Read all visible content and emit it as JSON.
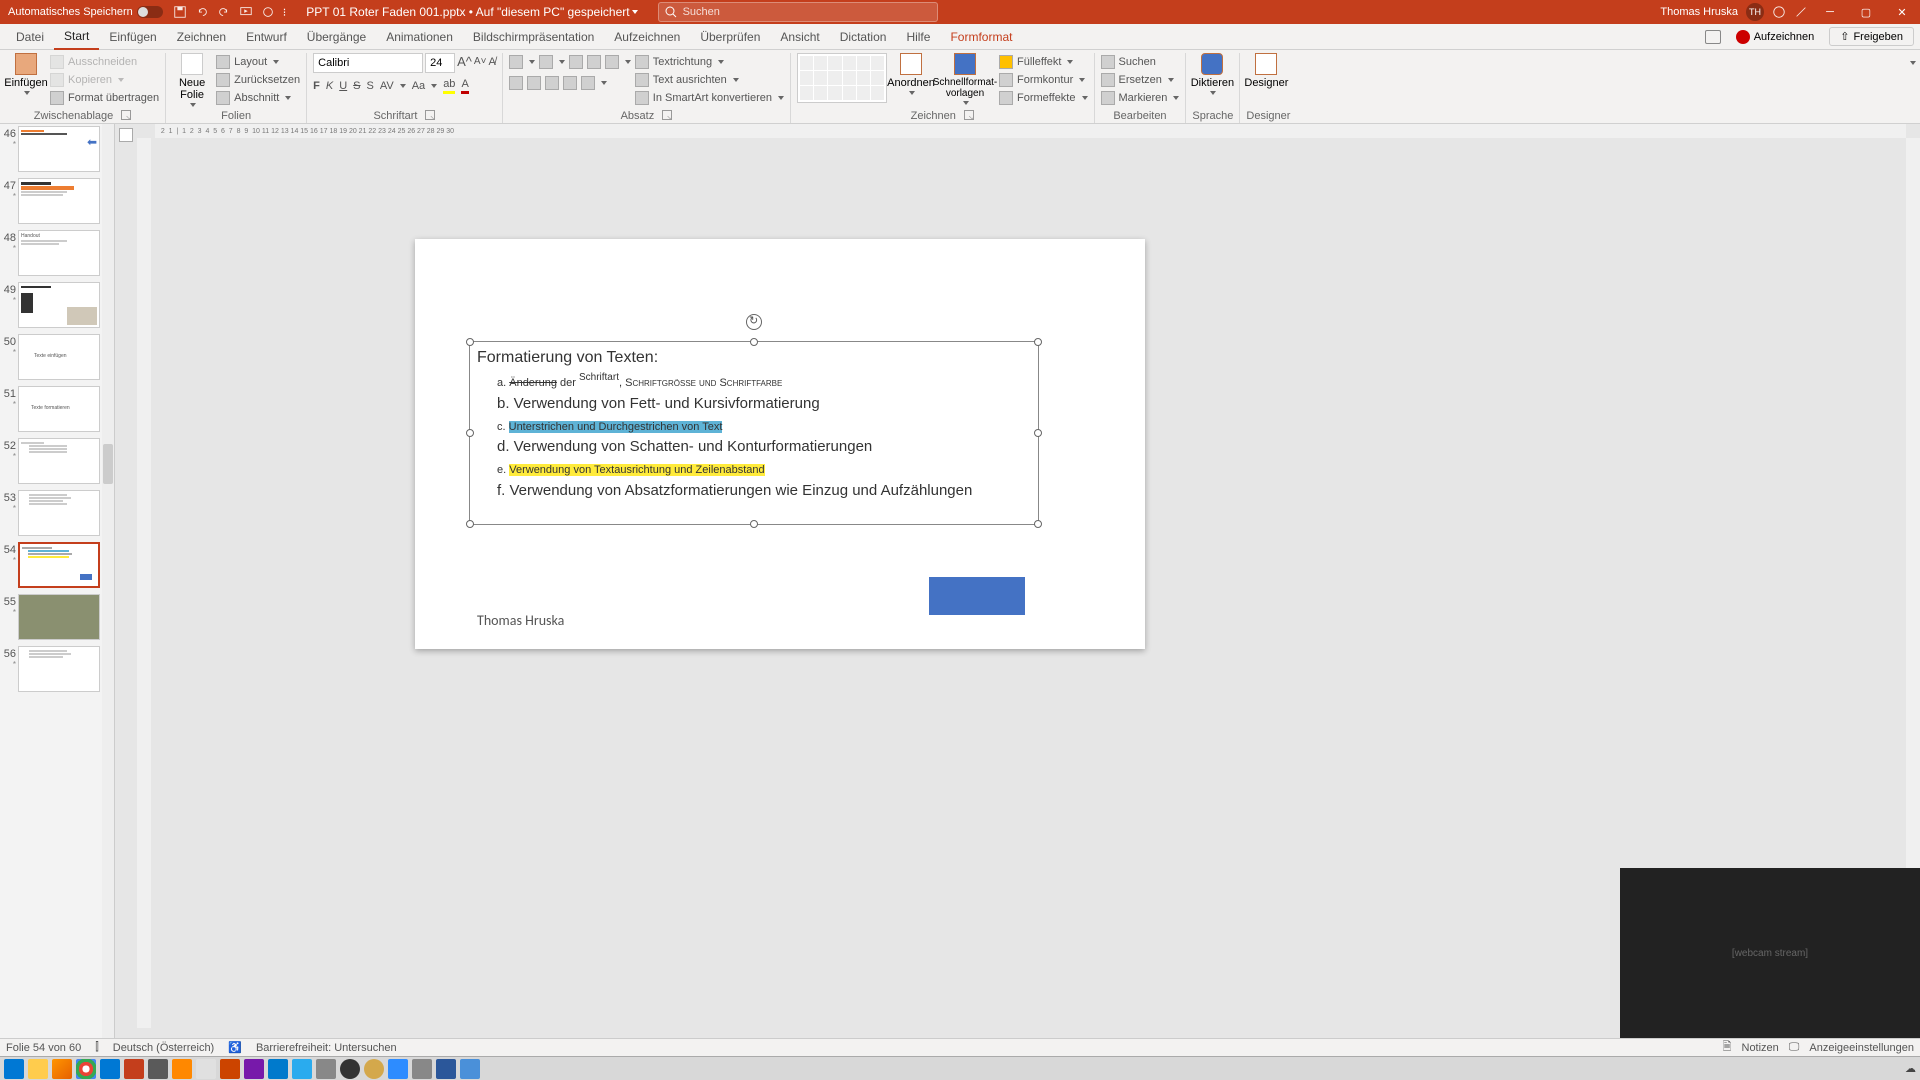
{
  "titlebar": {
    "autosave": "Automatisches Speichern",
    "filename": "PPT 01 Roter Faden 001.pptx • Auf \"diesem PC\" gespeichert",
    "search_placeholder": "Suchen",
    "username": "Thomas Hruska",
    "initials": "TH"
  },
  "tabs": {
    "datei": "Datei",
    "start": "Start",
    "einfuegen": "Einfügen",
    "zeichnen": "Zeichnen",
    "entwurf": "Entwurf",
    "uebergaenge": "Übergänge",
    "animationen": "Animationen",
    "bildschirm": "Bildschirmpräsentation",
    "aufzeichnen": "Aufzeichnen",
    "ueberpruefen": "Überprüfen",
    "ansicht": "Ansicht",
    "dictation": "Dictation",
    "hilfe": "Hilfe",
    "formformat": "Formformat",
    "record_btn": "Aufzeichnen",
    "share_btn": "Freigeben"
  },
  "ribbon": {
    "zwischenablage": {
      "label": "Zwischenablage",
      "einfuegen": "Einfügen",
      "ausschneiden": "Ausschneiden",
      "kopieren": "Kopieren",
      "format_uebertragen": "Format übertragen"
    },
    "folien": {
      "label": "Folien",
      "neue_folie": "Neue\nFolie",
      "layout": "Layout",
      "zuruecksetzen": "Zurücksetzen",
      "abschnitt": "Abschnitt"
    },
    "schriftart": {
      "label": "Schriftart",
      "font": "Calibri",
      "size": "24",
      "bold": "F",
      "italic": "K",
      "underline": "U",
      "strike": "S"
    },
    "absatz": {
      "label": "Absatz",
      "textrichtung": "Textrichtung",
      "text_ausrichten": "Text ausrichten",
      "smartart": "In SmartArt konvertieren"
    },
    "zeichnen": {
      "label": "Zeichnen",
      "anordnen": "Anordnen",
      "schnell": "Schnellformat-\nvorlagen",
      "fuelleffekt": "Fülleffekt",
      "formkontur": "Formkontur",
      "formeffekte": "Formeffekte"
    },
    "bearbeiten": {
      "label": "Bearbeiten",
      "suchen": "Suchen",
      "ersetzen": "Ersetzen",
      "markieren": "Markieren"
    },
    "sprache": {
      "label": "Sprache",
      "diktieren": "Diktieren"
    },
    "designer": {
      "label": "Designer",
      "designer": "Designer"
    }
  },
  "thumbs": {
    "n46": "46",
    "n47": "47",
    "n48": "48",
    "n49": "49",
    "n50": "50",
    "n51": "51",
    "n52": "52",
    "n53": "53",
    "n54": "54",
    "n55": "55",
    "n56": "56",
    "t48": "Handout",
    "t50": "Texte einfügen",
    "t51": "Texte formatieren"
  },
  "slide": {
    "title": "Formatierung von Texten:",
    "a_pre": "a. ",
    "a_strike": "Änderung",
    "a_mid1": " der ",
    "a_small": "Schriftart",
    "a_mid2": ", ",
    "a_sc": "Schriftgröße und Schriftfarbe",
    "b": "b. Verwendung von Fett- und Kursivformatierung",
    "c_pre": "c. ",
    "c_hl": "Unterstrichen und Durchgestrichen von Text",
    "d": "d. Verwendung von Schatten- und Konturformatierungen",
    "e_pre": "e. ",
    "e_hl": "Verwendung von Textausrichtung und Zeilenabstand",
    "f": "f. Verwendung von Absatzformatierungen wie Einzug und Aufzählungen",
    "author": "Thomas Hruska"
  },
  "status": {
    "slide_count": "Folie 54 von 60",
    "lang": "Deutsch (Österreich)",
    "access": "Barrierefreiheit: Untersuchen",
    "notizen": "Notizen",
    "anzeige": "Anzeigeeinstellungen"
  },
  "webcam_placeholder": "[webcam stream]"
}
